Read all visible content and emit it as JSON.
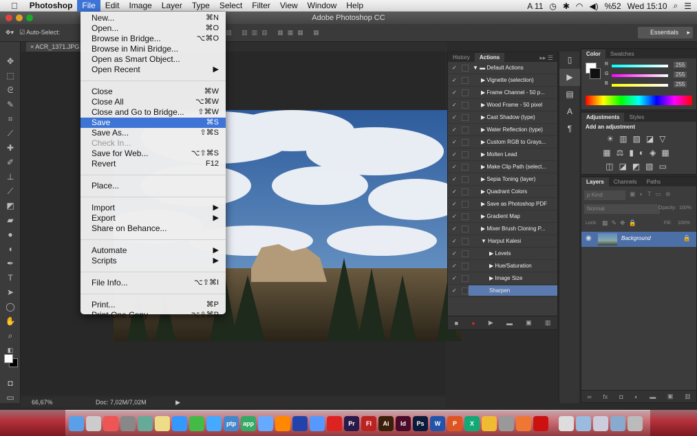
{
  "menubar": {
    "apple": "",
    "app": "Photoshop",
    "items": [
      "File",
      "Edit",
      "Image",
      "Layer",
      "Type",
      "Select",
      "Filter",
      "View",
      "Window",
      "Help"
    ],
    "active": "File",
    "right_left": "",
    "right_time": "Wed 15:10",
    "right_batt": "%52",
    "right_a": "A 11"
  },
  "titlebar": {
    "title": "Adobe Photoshop CC"
  },
  "options": {
    "autoselect": "Auto-Select:",
    "workspace": "Essentials"
  },
  "document": {
    "tab": "ACR_1371.JPG",
    "zoom": "66,67%",
    "doc": "Doc: 7,02M/7,02M"
  },
  "file_menu": {
    "items": [
      {
        "label": "New...",
        "shortcut": "⌘N"
      },
      {
        "label": "Open...",
        "shortcut": "⌘O"
      },
      {
        "label": "Browse in Bridge...",
        "shortcut": "⌥⌘O"
      },
      {
        "label": "Browse in Mini Bridge...",
        "shortcut": ""
      },
      {
        "label": "Open as Smart Object...",
        "shortcut": ""
      },
      {
        "label": "Open Recent",
        "shortcut": "▶"
      },
      {
        "label": "Close",
        "shortcut": "⌘W"
      },
      {
        "label": "Close All",
        "shortcut": "⌥⌘W"
      },
      {
        "label": "Close and Go to Bridge...",
        "shortcut": "⇧⌘W"
      },
      {
        "label": "Save",
        "shortcut": "⌘S"
      },
      {
        "label": "Save As...",
        "shortcut": "⇧⌘S"
      },
      {
        "label": "Check In...",
        "shortcut": ""
      },
      {
        "label": "Save for Web...",
        "shortcut": "⌥⇧⌘S"
      },
      {
        "label": "Revert",
        "shortcut": "F12"
      },
      {
        "label": "Place...",
        "shortcut": ""
      },
      {
        "label": "Import",
        "shortcut": "▶"
      },
      {
        "label": "Export",
        "shortcut": "▶"
      },
      {
        "label": "Share on Behance...",
        "shortcut": ""
      },
      {
        "label": "Automate",
        "shortcut": "▶"
      },
      {
        "label": "Scripts",
        "shortcut": "▶"
      },
      {
        "label": "File Info...",
        "shortcut": "⌥⇧⌘I"
      },
      {
        "label": "Print...",
        "shortcut": "⌘P"
      },
      {
        "label": "Print One Copy",
        "shortcut": "⌥⇧⌘P"
      }
    ],
    "selected": "Save",
    "disabled": [
      "Check In..."
    ]
  },
  "actions_panel": {
    "tabs": [
      "History",
      "Actions"
    ],
    "active_tab": "Actions",
    "rows": [
      {
        "label": "Default Actions",
        "level": 0,
        "open": true
      },
      {
        "label": "Vignette (selection)",
        "level": 1
      },
      {
        "label": "Frame Channel - 50 p...",
        "level": 1
      },
      {
        "label": "Wood Frame - 50 pixel",
        "level": 1
      },
      {
        "label": "Cast Shadow (type)",
        "level": 1
      },
      {
        "label": "Water Reflection (type)",
        "level": 1
      },
      {
        "label": "Custom RGB to Grays...",
        "level": 1
      },
      {
        "label": "Molten Lead",
        "level": 1
      },
      {
        "label": "Make Clip Path (select...",
        "level": 1
      },
      {
        "label": "Sepia Toning (layer)",
        "level": 1
      },
      {
        "label": "Quadrant Colors",
        "level": 1
      },
      {
        "label": "Save as Photoshop PDF",
        "level": 1
      },
      {
        "label": "Gradient Map",
        "level": 1
      },
      {
        "label": "Mixer Brush Cloning P...",
        "level": 1
      },
      {
        "label": "Harput Kalesi",
        "level": 1,
        "open": true
      },
      {
        "label": "Levels",
        "level": 2
      },
      {
        "label": "Hue/Saturation",
        "level": 2
      },
      {
        "label": "Image Size",
        "level": 2
      },
      {
        "label": "Sharpen",
        "level": 2,
        "highlight": true
      }
    ]
  },
  "color_panel": {
    "tabs": [
      "Color",
      "Swatches"
    ],
    "r": "255",
    "g": "255",
    "b": "255",
    "r_label": "R",
    "g_label": "G",
    "b_label": "B"
  },
  "adjustments_panel": {
    "tabs": [
      "Adjustments",
      "Styles"
    ],
    "heading": "Add an adjustment"
  },
  "layers_panel": {
    "tabs": [
      "Layers",
      "Channels",
      "Paths"
    ],
    "kind": "ρ Kind",
    "blend": "Normal",
    "opacity_label": "Opacity:",
    "opacity": "100%",
    "lock_label": "Lock:",
    "fill_label": "Fill:",
    "fill": "100%",
    "layer_name": "Background"
  },
  "colors": {
    "accent": "#3d74d6",
    "panel": "#3c3c3c",
    "dock": "#b8323b"
  }
}
